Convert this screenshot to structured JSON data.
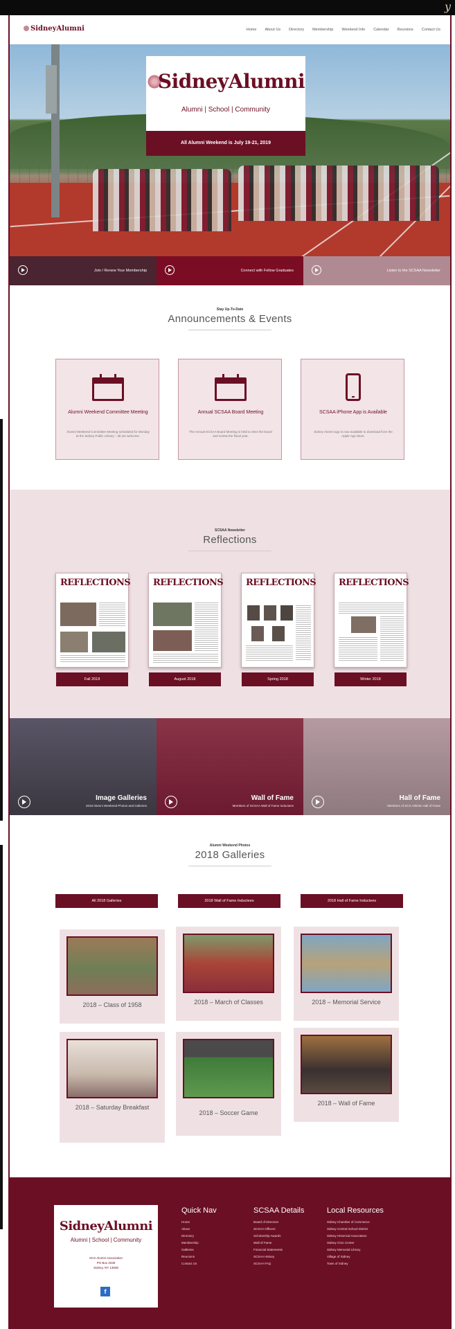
{
  "topbar": {
    "script_text": "y"
  },
  "header": {
    "logo": "SidneyAlumni",
    "nav": [
      "Home",
      "About Us",
      "Directory",
      "Membership",
      "Weekend Info",
      "Calendar",
      "Reunions",
      "Contact Us"
    ]
  },
  "hero": {
    "logo": "SidneyAlumni",
    "tagline": "Alumni | School | Community",
    "banner": "All Alumni Weekend is July 19-21, 2019"
  },
  "cta": [
    {
      "label": "Join / Renew Your Membership"
    },
    {
      "label": "Connect with Fellow Graduates"
    },
    {
      "label": "Listen to the SCSAA Newsletter"
    }
  ],
  "announcements": {
    "kicker": "Stay Up-To-Date",
    "title": "Announcements & Events",
    "cards": [
      {
        "icon": "calendar-icon",
        "title": "Alumni Weekend Committee Meeting",
        "text": "Alumni Weekend Committee Meeting scheduled for Monday at the Sidney Public Library – all are welcome."
      },
      {
        "icon": "calendar-icon",
        "title": "Annual SCSAA Board Meeting",
        "text": "The Annual SCSAA Board Meeting is held to elect the board and review the fiscal year."
      },
      {
        "icon": "phone-icon",
        "title": "SCSAA iPhone App is Available",
        "text": "Sidney Alumni app is now available to download from the Apple App Store."
      }
    ]
  },
  "reflections": {
    "kicker": "SCSAA Newsletter",
    "title": "Reflections",
    "masthead": "REFLECTIONS",
    "issues": [
      "Fall 2018",
      "August 2018",
      "Spring 2018",
      "Winter 2018"
    ]
  },
  "tiles": [
    {
      "title": "Image Galleries",
      "sub": "2018 Alumni Weekend Photos and Galleries"
    },
    {
      "title": "Wall of Fame",
      "sub": "Members of SCSAA Wall of Fame Inductees"
    },
    {
      "title": "Hall of Fame",
      "sub": "Members of SCS Athletic Hall of Fame"
    }
  ],
  "galleries": {
    "kicker": "Alumni Weekend Photos",
    "title": "2018 Galleries",
    "buttons": [
      "All 2018 Galleries",
      "2018 Wall of Fame Inductees",
      "2018 Hall of Fame Inductees"
    ],
    "cards": [
      {
        "caption": "2018 – Class of 1958"
      },
      {
        "caption": "2018 – March of Classes"
      },
      {
        "caption": "2018 – Memorial Service"
      },
      {
        "caption": "2018 – Saturday Breakfast"
      },
      {
        "caption": "2018 – Soccer Game"
      },
      {
        "caption": "2018 – Wall of Fame"
      }
    ]
  },
  "footer": {
    "logo": "SidneyAlumni",
    "tagline": "Alumni | School | Community",
    "address": [
      "SCS Alumni Association",
      "PO Box 2035",
      "Sidney, NY 13838"
    ],
    "facebook": "f",
    "quick_nav": {
      "title": "Quick Nav",
      "items": [
        "Home",
        "About",
        "Directory",
        "Membership",
        "Galleries",
        "Reunions",
        "Contact Us"
      ]
    },
    "details": {
      "title": "SCSAA Details",
      "items": [
        "Board of Directors",
        "SCSAA Officers",
        "Scholarship Awards",
        "Wall of Fame",
        "Financial Statements",
        "SCSAA History",
        "SCSAA FAQ"
      ]
    },
    "local": {
      "title": "Local Resources",
      "items": [
        "Sidney Chamber of Commerce",
        "Sidney Central School District",
        "Sidney Historical Association",
        "Sidney Civic Center",
        "Sidney Memorial Library",
        "Village of Sidney",
        "Town of Sidney"
      ]
    }
  },
  "colors": {
    "maroon": "#6b0f24",
    "blush": "#efe1e3"
  }
}
